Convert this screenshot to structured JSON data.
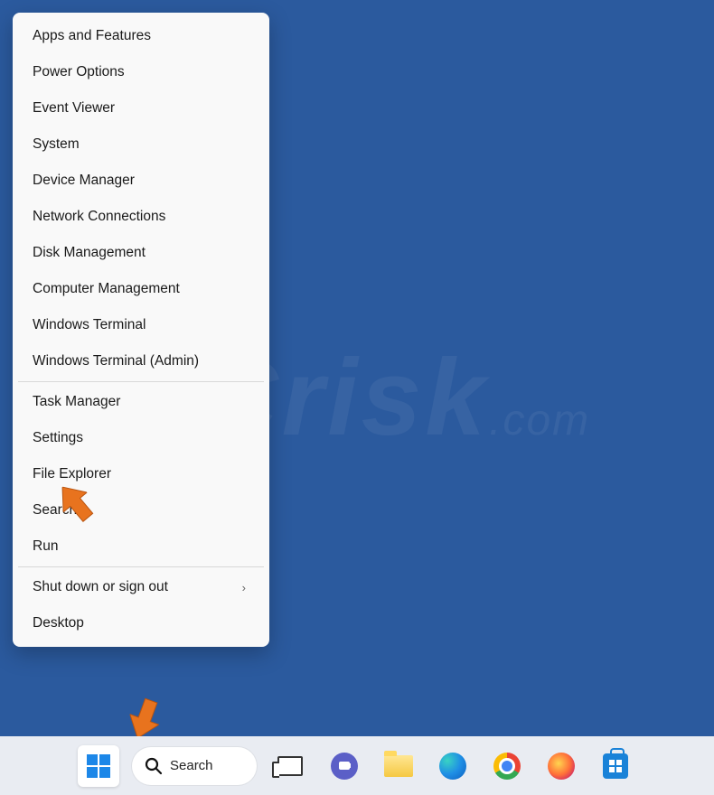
{
  "menu": {
    "groups": [
      [
        "Apps and Features",
        "Power Options",
        "Event Viewer",
        "System",
        "Device Manager",
        "Network Connections",
        "Disk Management",
        "Computer Management",
        "Windows Terminal",
        "Windows Terminal (Admin)"
      ],
      [
        "Task Manager",
        "Settings",
        "File Explorer",
        "Search",
        "Run"
      ],
      [
        "Shut down or sign out",
        "Desktop"
      ]
    ],
    "submenu_item": "Shut down or sign out"
  },
  "taskbar": {
    "search_label": "Search"
  },
  "watermark": {
    "main": "PCrisk",
    "sub": ".com"
  }
}
